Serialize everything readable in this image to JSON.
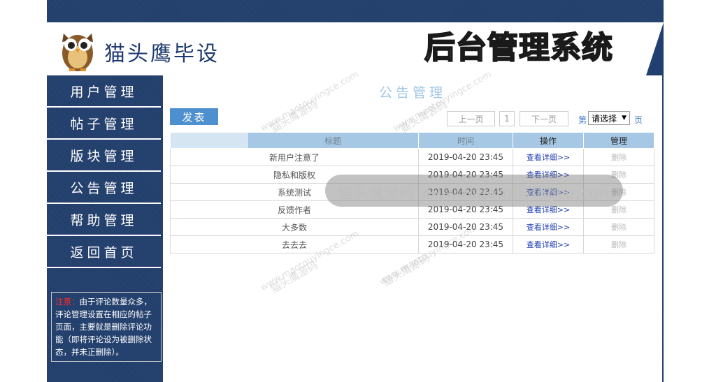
{
  "header": {
    "site_name": "猫头鹰毕设",
    "system_title": "后台管理系统"
  },
  "sidebar": {
    "items": [
      {
        "label": "用户管理"
      },
      {
        "label": "帖子管理"
      },
      {
        "label": "版块管理"
      },
      {
        "label": "公告管理"
      },
      {
        "label": "帮助管理"
      },
      {
        "label": "返回首页"
      }
    ],
    "notice": {
      "warn_label": "注意：",
      "text": "由于评论数量众多，评论管理设置在相应的帖子页面，主要就是删除评论功能（即将评论设为被删除状态，并未正删除）。"
    }
  },
  "main": {
    "title": "公告管理",
    "post_button": "发表",
    "pager": {
      "prev": "上一页",
      "current": "1",
      "next": "下一页",
      "label_before": "第",
      "select_value": "请选择",
      "label_after": "页"
    },
    "table": {
      "headers": [
        "标题",
        "时间",
        "操作",
        "管理"
      ],
      "rows": [
        {
          "title": "新用户注意了",
          "time": "2019-04-20 23:45",
          "action": "查看详细>>",
          "manage": "删除"
        },
        {
          "title": "隐私和版权",
          "time": "2019-04-20 23:45",
          "action": "查看详细>>",
          "manage": "删除"
        },
        {
          "title": "系统测试",
          "time": "2019-04-20 23:45",
          "action": "查看详细>>",
          "manage": "删除"
        },
        {
          "title": "反馈作者",
          "time": "2019-04-20 23:45",
          "action": "查看详细>>",
          "manage": "删除"
        },
        {
          "title": "大多数",
          "time": "2019-04-20 23:45",
          "action": "查看详细>>",
          "manage": "删除"
        },
        {
          "title": "去去去",
          "time": "2019-04-20 23:45",
          "action": "查看详细>>",
          "manage": "删除"
        }
      ]
    }
  },
  "watermark": {
    "brand": "猫头鹰源码",
    "url": "www.maotouyingce.com",
    "bar_text": "猫头鹰源码 www.maotouyingce.com"
  },
  "colors": {
    "denim": "#22406f",
    "accent": "#4e8fcf",
    "table_header": "#a6c8e4",
    "warning": "#ff2a2a",
    "link": "#1e3db4"
  }
}
